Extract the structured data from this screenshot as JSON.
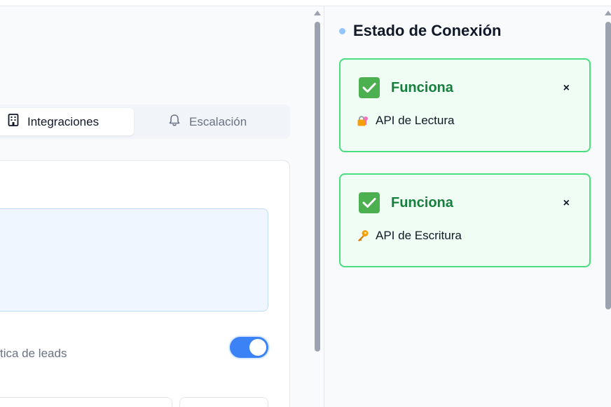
{
  "tabs": {
    "integrations_label": "Integraciones",
    "escalation_label": "Escalación"
  },
  "settings": {
    "lead_toggle_label": "tica de leads",
    "lead_toggle_on": true
  },
  "connection_status": {
    "title": "Estado de Conexión",
    "cards": [
      {
        "status": "Funciona",
        "api_label": "API de Lectura",
        "icon": "lock-key-icon",
        "close": "×"
      },
      {
        "status": "Funciona",
        "api_label": "API de Escritura",
        "icon": "key-icon",
        "close": "×"
      }
    ]
  },
  "colors": {
    "accent": "#3b82f6",
    "success": "#15803d",
    "success_border": "#4ade80"
  }
}
